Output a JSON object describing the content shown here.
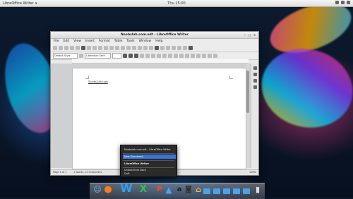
{
  "top_panel": {
    "app_name": "LibreOffice Writer",
    "clock": "Thu 15:00"
  },
  "window": {
    "title": "Noobslab.com.odt - LibreOffice Writer",
    "menu": [
      "File",
      "Edit",
      "View",
      "Insert",
      "Format",
      "Table",
      "Tools",
      "Window",
      "Help"
    ],
    "style_combo": "Default Style",
    "font_combo": "Liberation Serif",
    "document_text": "NoobsLab.com",
    "status": {
      "page": "Page 1 of 1",
      "words": "1 words, 12 characters",
      "zoom": "100%"
    }
  },
  "popup": {
    "doc_item": "Noobslab.com.odt - LibreOffice Writer",
    "new_doc": "New Document",
    "app_item": "LibreOffice Writer",
    "unlock": "Unlock from Dock",
    "quit": "Quit"
  },
  "dock": {
    "icons": [
      "finder-icon",
      "firefox-icon",
      "libreoffice-writer-icon",
      "libreoffice-calc-icon",
      "libreoffice-impress-icon",
      "app-store-icon",
      "amazon-icon",
      "camera-icon",
      "home-icon",
      "folder-icon",
      "trash-icon"
    ]
  }
}
